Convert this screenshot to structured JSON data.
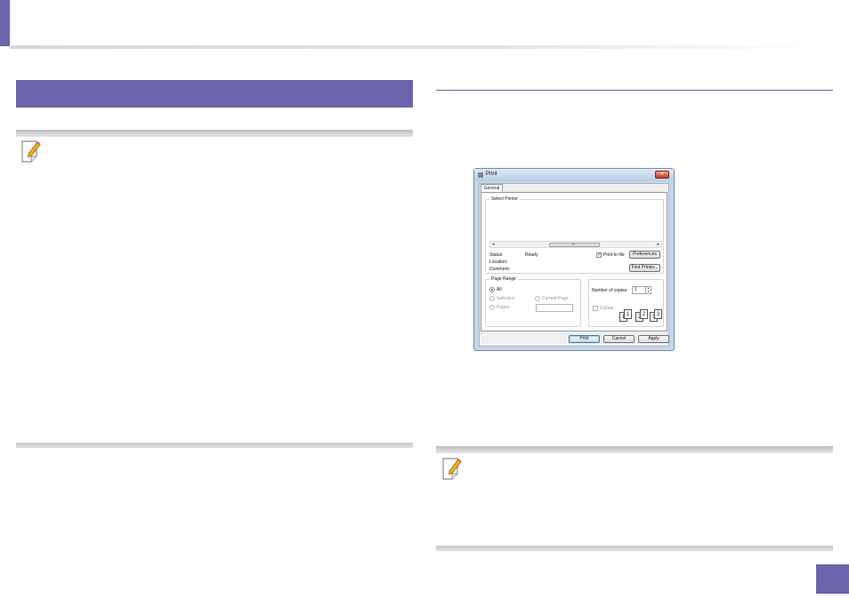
{
  "print_dialog": {
    "title": "Print",
    "close_label": "✕",
    "tab_general": "General",
    "select_printer_label": "Select Printer",
    "status_label": "Status:",
    "status_value": "Ready",
    "location_label": "Location:",
    "comment_label": "Comment:",
    "print_to_file_label": "Print to file",
    "preferences_button": "Preferences",
    "find_printer_button": "Find Printer...",
    "page_range_label": "Page Range",
    "range_all": "All",
    "range_selection": "Selection",
    "range_current_page": "Current Page",
    "range_pages": "Pages:",
    "copies_label": "Number of copies:",
    "copies_value": "1",
    "collate_label": "Collate",
    "print_button": "Print",
    "cancel_button": "Cancel",
    "apply_button": "Apply",
    "scroll_grip": "III",
    "collate_pages": [
      "1",
      "1",
      "2",
      "2",
      "3",
      "3"
    ]
  },
  "colors": {
    "accent": "#6b64aa"
  },
  "icons": {
    "note_icon": "pencil-note-icon"
  }
}
